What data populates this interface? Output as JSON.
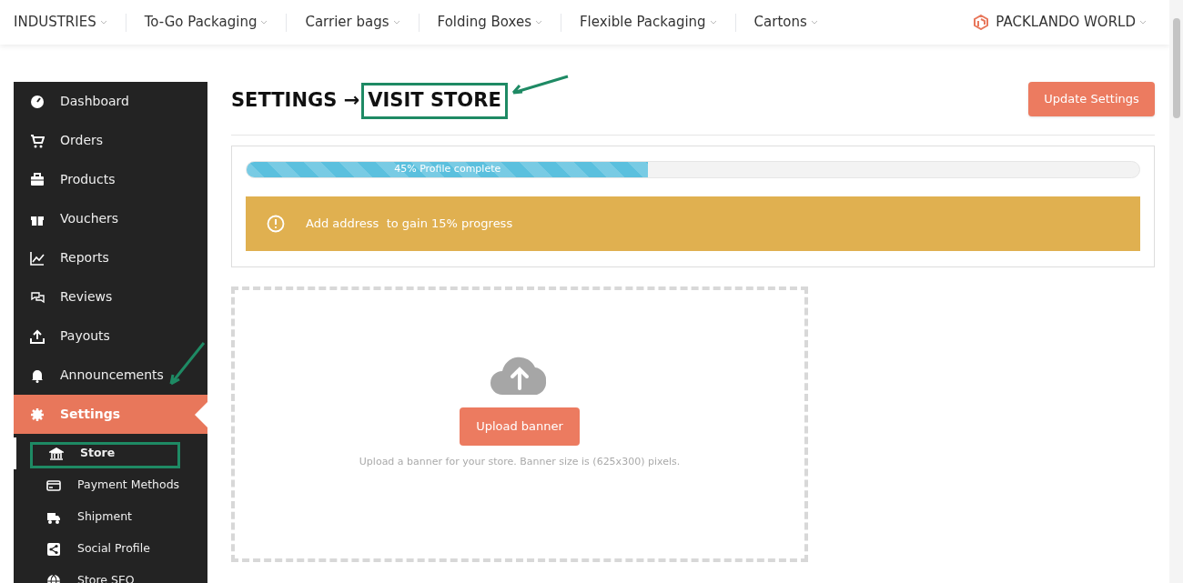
{
  "top_nav": {
    "items": [
      "INDUSTRIES",
      "To-Go Packaging",
      "Carrier bags",
      "Folding Boxes",
      "Flexible Packaging",
      "Cartons"
    ],
    "brand": "PACKLANDO WORLD"
  },
  "sidebar": {
    "items": [
      {
        "label": "Dashboard",
        "selected": false
      },
      {
        "label": "Orders",
        "selected": false
      },
      {
        "label": "Products",
        "selected": false
      },
      {
        "label": "Vouchers",
        "selected": false
      },
      {
        "label": "Reports",
        "selected": false
      },
      {
        "label": "Reviews",
        "selected": false
      },
      {
        "label": "Payouts",
        "selected": false
      },
      {
        "label": "Announcements",
        "selected": false
      },
      {
        "label": "Settings",
        "selected": true
      }
    ],
    "sub_items": [
      {
        "label": "Store",
        "selected": true
      },
      {
        "label": "Payment Methods",
        "selected": false
      },
      {
        "label": "Shipment",
        "selected": false
      },
      {
        "label": "Social Profile",
        "selected": false
      },
      {
        "label": "Store SEO",
        "selected": false
      }
    ]
  },
  "header": {
    "title": "SETTINGS →",
    "title_link": "VISIT STORE",
    "button": "Update Settings"
  },
  "progress": {
    "label": "45% Profile complete",
    "level": 0.45
  },
  "alert": {
    "text": "Add address  to gain 15% progress"
  },
  "upload": {
    "button": "Upload banner",
    "hint": "Upload a banner for your store. Banner size is (625x300) pixels."
  }
}
